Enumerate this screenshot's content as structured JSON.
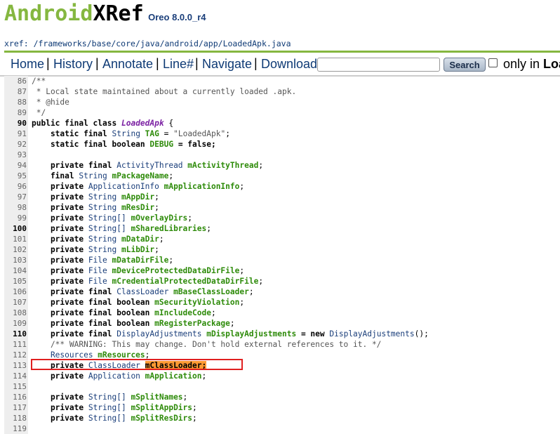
{
  "header": {
    "logo_android": "Android",
    "logo_xref": "XRef",
    "version": "Oreo 8.0.0_r4",
    "path_prefix": "xref:",
    "path": "/frameworks/base/core/java/android/app/LoadedApk.java"
  },
  "nav": {
    "home": "Home",
    "history": "History",
    "annotate": "Annotate",
    "line": "Line#",
    "navigate": "Navigate",
    "download": "Download",
    "search_button": "Search",
    "only_in": "only in",
    "only_in_bold": "Loa",
    "search_value": ""
  },
  "colors": {
    "accent_green": "#85b740",
    "link_blue": "#0e3a75",
    "highlight_orange": "#ff9933",
    "annotation_red": "#e02020"
  },
  "code": {
    "n86": "86",
    "t86": "/**",
    "n87": "87",
    "t87": " * Local state maintained about a currently loaded .apk.",
    "n88": "88",
    "t88": " * @hide",
    "n89": "89",
    "t89": " */",
    "n90": "90",
    "t90a": "public final class ",
    "t90b": "LoadedApk",
    "t90c": " {",
    "n91": "91",
    "t91a": "    static final ",
    "t91b": "String",
    "t91c": " TAG",
    "t91d": " = ",
    "t91e": "\"LoadedApk\"",
    "t91f": ";",
    "n92": "92",
    "t92a": "    static final boolean ",
    "t92b": "DEBUG",
    "t92c": " = false;",
    "n93": "93",
    "n94": "94",
    "t94a": "    private final ",
    "t94b": "ActivityThread",
    "t94c": " mActivityThread",
    "t94d": ";",
    "n95": "95",
    "t95a": "    final ",
    "t95b": "String",
    "t95c": " mPackageName",
    "t95d": ";",
    "n96": "96",
    "t96a": "    private ",
    "t96b": "ApplicationInfo",
    "t96c": " mApplicationInfo",
    "t96d": ";",
    "n97": "97",
    "t97a": "    private ",
    "t97b": "String",
    "t97c": " mAppDir",
    "t97d": ";",
    "n98": "98",
    "t98a": "    private ",
    "t98b": "String",
    "t98c": " mResDir",
    "t98d": ";",
    "n99": "99",
    "t99a": "    private ",
    "t99b": "String[]",
    "t99c": " mOverlayDirs",
    "t99d": ";",
    "n100": "100",
    "t100a": "    private ",
    "t100b": "String[]",
    "t100c": " mSharedLibraries",
    "t100d": ";",
    "n101": "101",
    "t101a": "    private ",
    "t101b": "String",
    "t101c": " mDataDir",
    "t101d": ";",
    "n102": "102",
    "t102a": "    private ",
    "t102b": "String",
    "t102c": " mLibDir",
    "t102d": ";",
    "n103": "103",
    "t103a": "    private ",
    "t103b": "File",
    "t103c": " mDataDirFile",
    "t103d": ";",
    "n104": "104",
    "t104a": "    private ",
    "t104b": "File",
    "t104c": " mDeviceProtectedDataDirFile",
    "t104d": ";",
    "n105": "105",
    "t105a": "    private ",
    "t105b": "File",
    "t105c": " mCredentialProtectedDataDirFile",
    "t105d": ";",
    "n106": "106",
    "t106a": "    private final ",
    "t106b": "ClassLoader",
    "t106c": " mBaseClassLoader",
    "t106d": ";",
    "n107": "107",
    "t107a": "    private final boolean",
    "t107c": " mSecurityViolation",
    "t107d": ";",
    "n108": "108",
    "t108a": "    private final boolean",
    "t108c": " mIncludeCode",
    "t108d": ";",
    "n109": "109",
    "t109a": "    private final boolean",
    "t109c": " mRegisterPackage",
    "t109d": ";",
    "n110": "110",
    "t110a": "    private final ",
    "t110b": "DisplayAdjustments",
    "t110c": " mDisplayAdjustments",
    "t110d": " = new ",
    "t110e": "DisplayAdjustments",
    "t110f": "();",
    "n111": "111",
    "t111": "    /** WARNING: This may change. Don't hold external references to it. */",
    "n112": "112",
    "t112b": "    Resources",
    "t112c": " mResources",
    "t112d": ";",
    "n113": "113",
    "t113a": "    private ",
    "t113b": "ClassLoader",
    "t113c": " ",
    "t113e": "mClassLoader",
    "t113d": ";",
    "n114": "114",
    "t114a": "    private ",
    "t114b": "Application",
    "t114c": " mApplication",
    "t114d": ";",
    "n115": "115",
    "n116": "116",
    "t116a": "    private ",
    "t116b": "String[]",
    "t116c": " mSplitNames",
    "t116d": ";",
    "n117": "117",
    "t117a": "    private ",
    "t117b": "String[]",
    "t117c": " mSplitAppDirs",
    "t117d": ";",
    "n118": "118",
    "t118a": "    private ",
    "t118b": "String[]",
    "t118c": " mSplitResDirs",
    "t118d": ";",
    "n119": "119"
  }
}
